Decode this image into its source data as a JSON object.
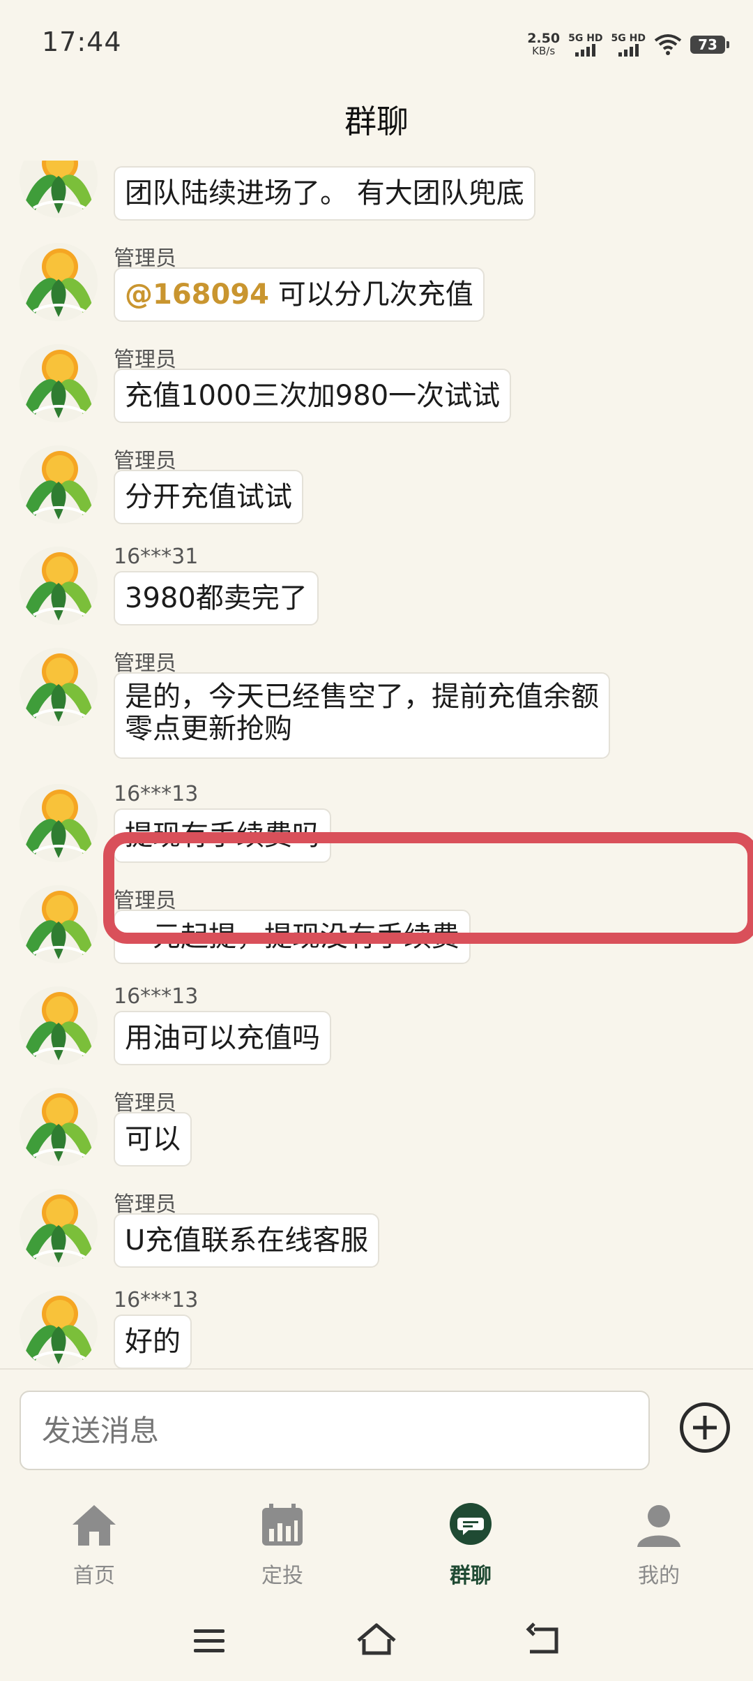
{
  "status_bar": {
    "time": "17:44",
    "net_speed_value": "2.50",
    "net_speed_unit": "KB/s",
    "sim1": "5G HD",
    "sim2": "5G HD",
    "battery": "73"
  },
  "header": {
    "title": "群聊"
  },
  "messages": [
    {
      "sender": "",
      "text": "团队陆续进场了。 有大团队兜底"
    },
    {
      "sender": "管理员",
      "mention": "@168094",
      "text": " 可以分几次充值"
    },
    {
      "sender": "管理员",
      "text": "充值1000三次加980一次试试"
    },
    {
      "sender": "管理员",
      "text": "分开充值试试"
    },
    {
      "sender": "16***31",
      "text": "3980都卖完了"
    },
    {
      "sender": "管理员",
      "text_line1": "是的，今天已经售空了，提前充值余额",
      "text_line2": "零点更新抢购"
    },
    {
      "sender": "16***13",
      "text": "提现有手续费吗"
    },
    {
      "sender": "管理员",
      "text": "一元起提，提现没有手续费"
    },
    {
      "sender": "16***13",
      "text": "用油可以充值吗"
    },
    {
      "sender": "管理员",
      "text": "可以"
    },
    {
      "sender": "管理员",
      "text": "U充值联系在线客服"
    },
    {
      "sender": "16***13",
      "text": "好的"
    }
  ],
  "composer": {
    "placeholder": "发送消息"
  },
  "tabs": [
    {
      "label": "首页",
      "icon": "home-icon"
    },
    {
      "label": "定投",
      "icon": "calendar-chart-icon"
    },
    {
      "label": "群聊",
      "icon": "chat-icon",
      "active": true
    },
    {
      "label": "我的",
      "icon": "profile-icon"
    }
  ],
  "colors": {
    "accent": "#1f4a33",
    "highlight": "#d9505a",
    "mention": "#c9952f",
    "background": "#f8f5ec"
  }
}
